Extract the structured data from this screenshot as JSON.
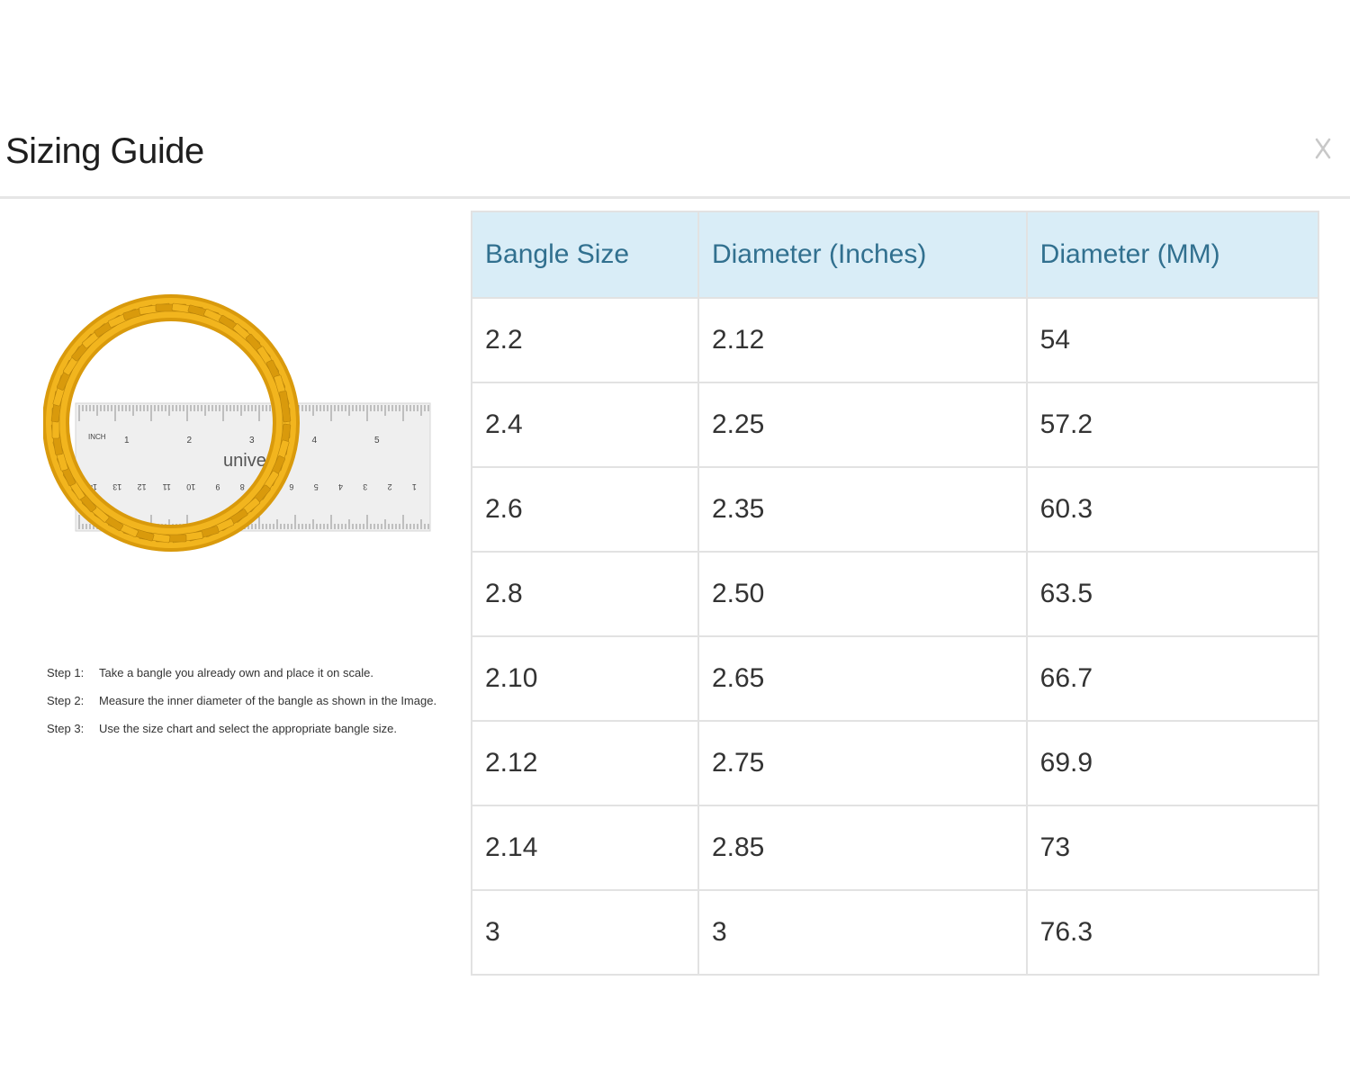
{
  "modal": {
    "title": "Sizing Guide",
    "close_label": "X"
  },
  "illustration": {
    "ruler_inch_label": "INCH",
    "ruler_brand": "universa",
    "ruler_inch_ticks": [
      "1",
      "2",
      "3",
      "4",
      "5"
    ],
    "ruler_cm_ticks": [
      "14",
      "13",
      "12",
      "11",
      "10",
      "9",
      "8",
      "7",
      "6",
      "5",
      "4",
      "3",
      "2",
      "1"
    ],
    "colors": {
      "bangle": "#f2b51e",
      "bangle_dark": "#d99a0c",
      "ruler": "#eeeeee"
    }
  },
  "steps": [
    {
      "label": "Step 1:",
      "text": "Take a bangle you already own and place it on scale."
    },
    {
      "label": "Step 2:",
      "text": "Measure the inner diameter of the bangle as shown in the Image."
    },
    {
      "label": "Step 3:",
      "text": "Use the size chart and select the appropriate bangle size."
    }
  ],
  "table": {
    "headers": [
      "Bangle Size",
      "Diameter (Inches)",
      "Diameter (MM)"
    ],
    "rows": [
      [
        "2.2",
        "2.12",
        "54"
      ],
      [
        "2.4",
        "2.25",
        "57.2"
      ],
      [
        "2.6",
        "2.35",
        "60.3"
      ],
      [
        "2.8",
        "2.50",
        "63.5"
      ],
      [
        "2.10",
        "2.65",
        "66.7"
      ],
      [
        "2.12",
        "2.75",
        "69.9"
      ],
      [
        "2.14",
        "2.85",
        "73"
      ],
      [
        "3",
        "3",
        "76.3"
      ]
    ],
    "colors": {
      "header_bg": "#d9edf7",
      "header_text": "#31708f",
      "border": "#e2e2e2"
    }
  }
}
